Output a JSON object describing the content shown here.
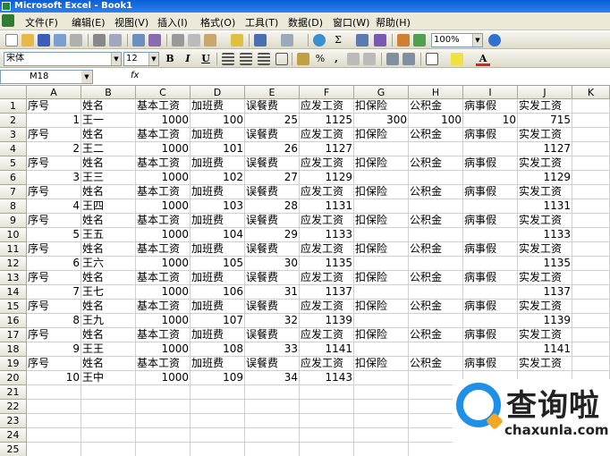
{
  "window": {
    "title": "Microsoft Excel - Book1"
  },
  "menu": [
    "文件(F)",
    "编辑(E)",
    "视图(V)",
    "插入(I)",
    "格式(O)",
    "工具(T)",
    "数据(D)",
    "窗口(W)",
    "帮助(H)"
  ],
  "toolbar": {
    "zoom": "100%",
    "font": "宋体",
    "font_size": "12",
    "bold": "B",
    "italic": "I",
    "underline": "U",
    "percent": "%",
    "comma": ","
  },
  "formula_bar": {
    "name_box": "M18",
    "fx": "fx"
  },
  "columns": [
    "A",
    "B",
    "C",
    "D",
    "E",
    "F",
    "G",
    "H",
    "I",
    "J",
    "K"
  ],
  "rows": [
    "1",
    "2",
    "3",
    "4",
    "5",
    "6",
    "7",
    "8",
    "9",
    "10",
    "11",
    "12",
    "13",
    "14",
    "15",
    "16",
    "17",
    "18",
    "19",
    "20",
    "21",
    "22",
    "23",
    "24",
    "25"
  ],
  "header_row": [
    "序号",
    "姓名",
    "基本工资",
    "加班费",
    "误餐费",
    "应发工资",
    "扣保险",
    "公积金",
    "病事假",
    "实发工资"
  ],
  "data": [
    {
      "no": "1",
      "name": "王一",
      "base": "1000",
      "ot": "100",
      "meal": "25",
      "gross": "1125",
      "ins": "300",
      "fund": "100",
      "leave": "10",
      "net": "715"
    },
    {
      "no": "2",
      "name": "王二",
      "base": "1000",
      "ot": "101",
      "meal": "26",
      "gross": "1127",
      "ins": "",
      "fund": "",
      "leave": "",
      "net": "1127"
    },
    {
      "no": "3",
      "name": "王三",
      "base": "1000",
      "ot": "102",
      "meal": "27",
      "gross": "1129",
      "ins": "",
      "fund": "",
      "leave": "",
      "net": "1129"
    },
    {
      "no": "4",
      "name": "王四",
      "base": "1000",
      "ot": "103",
      "meal": "28",
      "gross": "1131",
      "ins": "",
      "fund": "",
      "leave": "",
      "net": "1131"
    },
    {
      "no": "5",
      "name": "王五",
      "base": "1000",
      "ot": "104",
      "meal": "29",
      "gross": "1133",
      "ins": "",
      "fund": "",
      "leave": "",
      "net": "1133"
    },
    {
      "no": "6",
      "name": "王六",
      "base": "1000",
      "ot": "105",
      "meal": "30",
      "gross": "1135",
      "ins": "",
      "fund": "",
      "leave": "",
      "net": "1135"
    },
    {
      "no": "7",
      "name": "王七",
      "base": "1000",
      "ot": "106",
      "meal": "31",
      "gross": "1137",
      "ins": "",
      "fund": "",
      "leave": "",
      "net": "1137"
    },
    {
      "no": "8",
      "name": "王九",
      "base": "1000",
      "ot": "107",
      "meal": "32",
      "gross": "1139",
      "ins": "",
      "fund": "",
      "leave": "",
      "net": "1139"
    },
    {
      "no": "9",
      "name": "王王",
      "base": "1000",
      "ot": "108",
      "meal": "33",
      "gross": "1141",
      "ins": "",
      "fund": "",
      "leave": "",
      "net": "1141"
    },
    {
      "no": "10",
      "name": "王中",
      "base": "1000",
      "ot": "109",
      "meal": "34",
      "gross": "1143",
      "ins": "",
      "fund": "",
      "leave": "",
      "net": ""
    }
  ],
  "watermark": {
    "brand": "查询啦",
    "domain": "chaxunla.com"
  },
  "colors": {
    "title_blue": "#0a5fd6",
    "toolbar": "#ece9d8",
    "header": "#e6e4d8",
    "logo_blue": "#1e90e8",
    "logo_orange": "#f5a623"
  }
}
